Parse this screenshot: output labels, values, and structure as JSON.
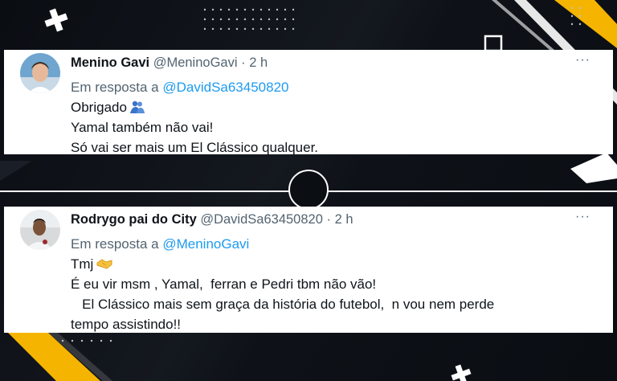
{
  "colors": {
    "link": "#1d9bf0",
    "muted": "#536471",
    "accent_yellow": "#f4b400"
  },
  "tweets": [
    {
      "name": "Menino Gavi",
      "handle": "@MeninoGavi",
      "sep": "·",
      "time": "2 h",
      "more": "···",
      "reply_prefix": "Em resposta a",
      "reply_to": "@DavidSa63450820",
      "lines": [
        "Obrigado",
        "Yamal também não vai!",
        "Só vai ser mais um El Clássico qualquer."
      ],
      "emoji": "people-hugging-icon"
    },
    {
      "name": "Rodrygo pai do City",
      "handle": "@DavidSa63450820",
      "sep": "·",
      "time": "2 h",
      "more": "···",
      "reply_prefix": "Em resposta a",
      "reply_to": "@MeninoGavi",
      "lines": [
        "Tmj",
        "É eu vir msm , Yamal,  ferran e Pedri tbm não vão!",
        "   El Clássico mais sem graça da história do futebol,  n vou nem perde",
        "tempo assistindo!!"
      ],
      "emoji": "handshake-icon"
    }
  ]
}
